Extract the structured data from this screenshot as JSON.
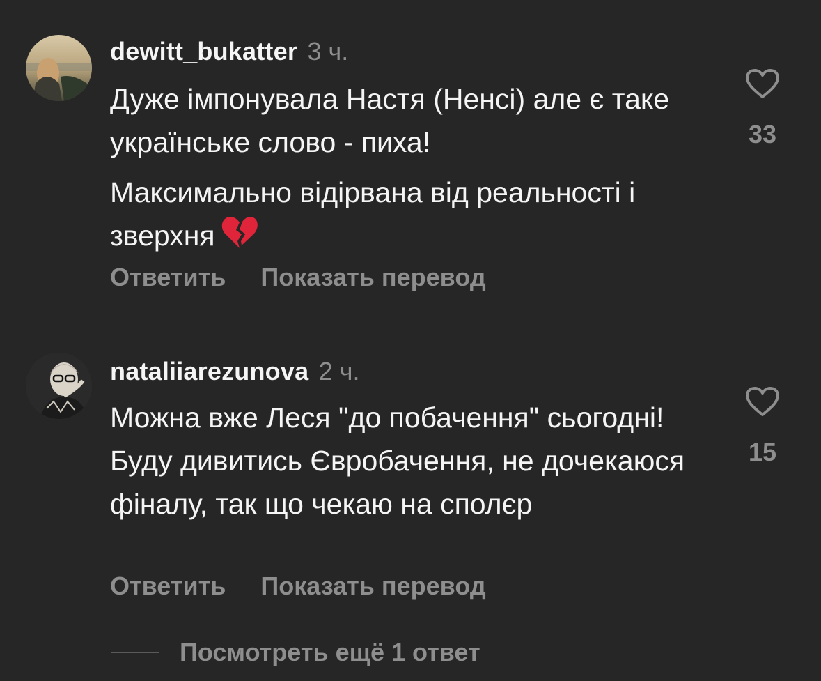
{
  "comments": [
    {
      "username": "dewitt_bukatter",
      "time": "3 ч.",
      "paragraphs": [
        "Дуже імпонувала Настя (Ненсі) але є таке українське слово - пиха!",
        "Максимально відірвана від реальності і зверхня"
      ],
      "emoji": "broken-heart-icon",
      "likes": "33",
      "reply_label": "Ответить",
      "translate_label": "Показать перевод"
    },
    {
      "username": "nataliiarezunova",
      "time": "2 ч.",
      "paragraphs": [
        "Можна вже Леся \"до побачення\" сьогодні! Буду дивитись Євробачення, не дочекаюся фіналу, так що чекаю на сполєр"
      ],
      "likes": "15",
      "reply_label": "Ответить",
      "translate_label": "Показать перевод"
    }
  ],
  "more_replies_label": "Посмотреть ещё 1 ответ",
  "colors": {
    "background": "#262626",
    "text_primary": "#f5f5f5",
    "text_secondary": "#8e8e8e"
  }
}
